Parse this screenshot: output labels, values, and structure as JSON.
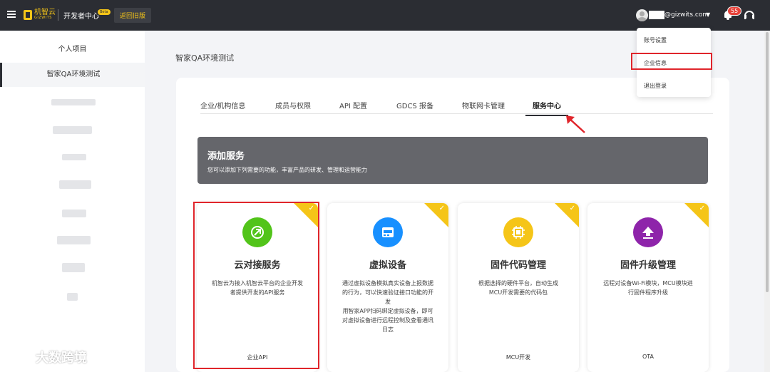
{
  "topbar": {
    "logo_text": "机智云",
    "logo_sub": "GIZWITS",
    "dev_center": "开发者中心",
    "beta": "Beta",
    "old_version": "返回旧版",
    "email": "@gizwits.com",
    "notification_count": "55"
  },
  "sidebar": {
    "items": [
      {
        "label": "个人项目"
      },
      {
        "label": "智家QA环境测试"
      }
    ]
  },
  "page": {
    "title": "智家QA环境测试"
  },
  "tabs": [
    {
      "label": "企业/机构信息"
    },
    {
      "label": "成员与权限"
    },
    {
      "label": "API 配置"
    },
    {
      "label": "GDCS 报备"
    },
    {
      "label": "物联网卡管理"
    },
    {
      "label": "服务中心"
    }
  ],
  "banner": {
    "title": "添加服务",
    "desc": "您可以添加下列需要的功能，丰富产品的研发、管理和运营能力"
  },
  "services": [
    {
      "title": "云对接服务",
      "desc": "机智云为接入机智云平台的企业开发者提供开发的API服务",
      "tag": "企业API",
      "icon": "cloud-link-icon",
      "color": "#52c41a"
    },
    {
      "title": "虚拟设备",
      "desc": "通过虚拟设备模拟真实设备上报数据的行为，可以快速验证接口功能的开发\n用智家APP扫码绑定虚拟设备，即可对虚拟设备进行远程控制及查看通讯日志",
      "tag": "",
      "icon": "virtual-device-icon",
      "color": "#1890ff"
    },
    {
      "title": "固件代码管理",
      "desc": "根据选择的硬件平台，自动生成MCU开发需要的代码包",
      "tag": "MCU开发",
      "icon": "chip-icon",
      "color": "#f5c518"
    },
    {
      "title": "固件升级管理",
      "desc": "远程对设备Wi-Fi模块，MCU模块进行固件程序升级",
      "tag": "OTA",
      "icon": "upload-icon",
      "color": "#8e24aa"
    }
  ],
  "dropdown": {
    "items": [
      {
        "label": "账号设置"
      },
      {
        "label": "企业信息"
      },
      {
        "label": "退出登录"
      }
    ]
  },
  "watermark": "大数跨境"
}
